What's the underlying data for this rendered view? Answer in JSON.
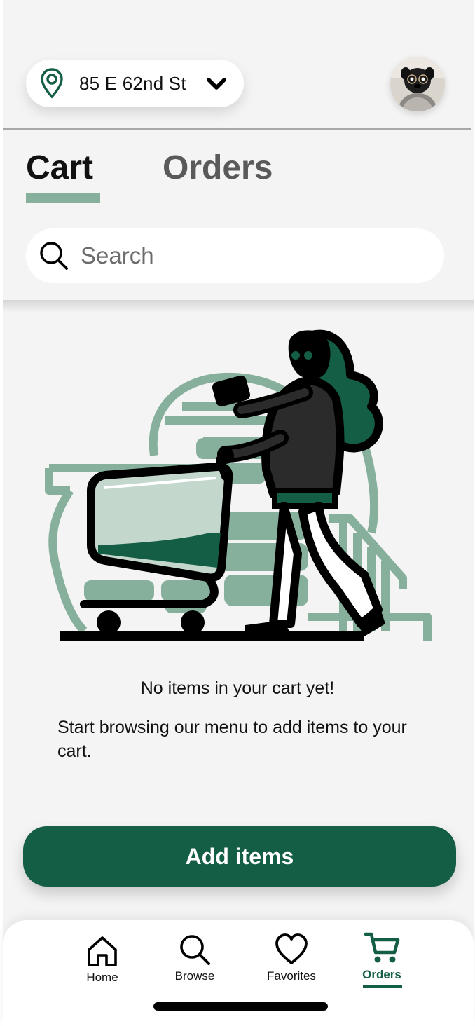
{
  "location": {
    "address": "85 E 62nd St",
    "icon": "map-pin-icon",
    "dropdown_icon": "chevron-down-icon"
  },
  "profile": {
    "avatar_icon": "avatar"
  },
  "tabs": [
    {
      "label": "Cart",
      "active": true
    },
    {
      "label": "Orders",
      "active": false
    }
  ],
  "search": {
    "placeholder": "Search",
    "value": ""
  },
  "empty_state": {
    "title": "No items in your cart yet!",
    "subtitle": "Start browsing our menu to add items to your cart.",
    "illustration": "shopper-with-cart-illustration"
  },
  "primary_action": {
    "label": "Add items"
  },
  "bottom_nav": {
    "items": [
      {
        "label": "Home",
        "icon": "home-icon",
        "active": false
      },
      {
        "label": "Browse",
        "icon": "search-icon",
        "active": false
      },
      {
        "label": "Favorites",
        "icon": "heart-icon",
        "active": false
      },
      {
        "label": "Orders",
        "icon": "cart-icon",
        "active": true
      }
    ]
  },
  "colors": {
    "accent": "#155e46",
    "accent_light": "#86b09c",
    "background": "#f4f4f4",
    "text": "#111111",
    "tab_inactive": "#5a5a5a"
  }
}
